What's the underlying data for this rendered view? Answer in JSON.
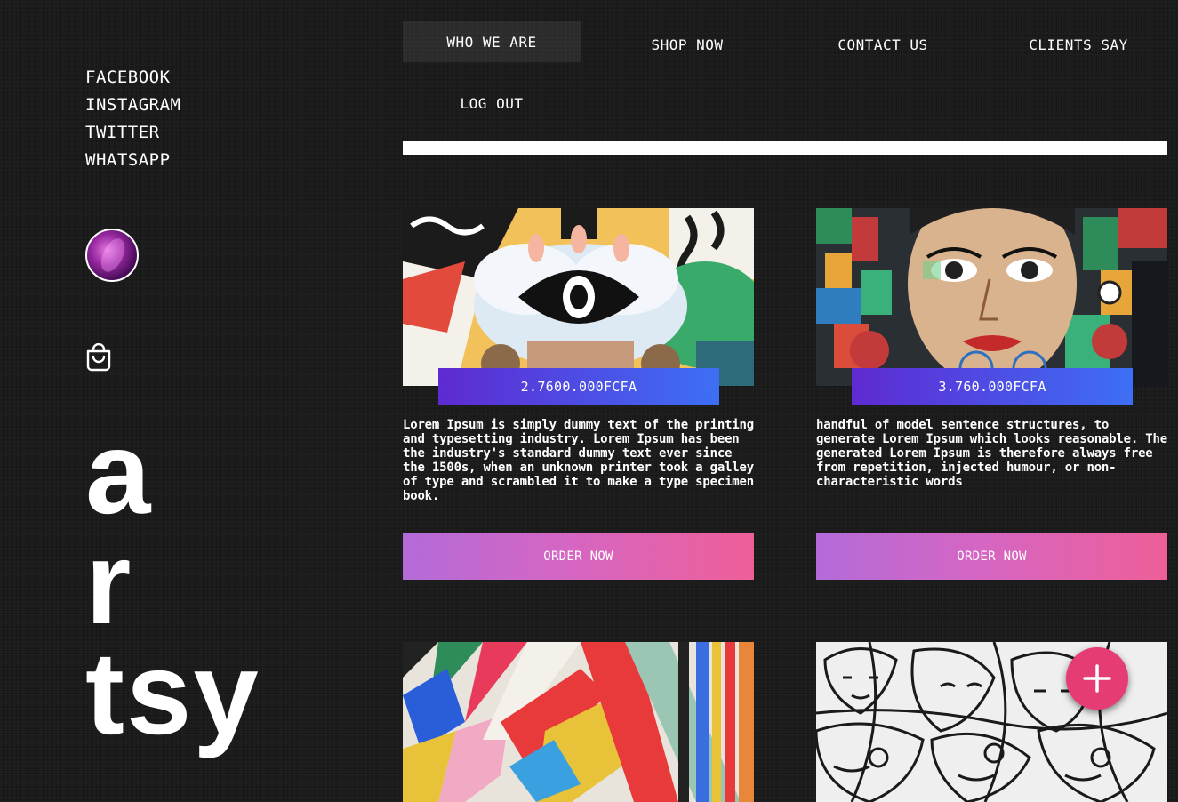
{
  "social": [
    "FACEBOOK",
    "INSTAGRAM",
    "TWITTER",
    "WHATSAPP"
  ],
  "brand": {
    "line1": "a",
    "line2": "r",
    "line3": "tsy"
  },
  "nav": {
    "who_we_are": "WHO WE ARE",
    "shop_now": "SHOP NOW",
    "contact_us": "CONTACT US",
    "clients_say": "CLIENTS SAY",
    "log_out": "LOG OUT"
  },
  "products": [
    {
      "price": "2.7600.000FCFA",
      "description": "Lorem Ipsum is simply dummy text of the printing and typesetting industry. Lorem Ipsum has been the industry's standard dummy text ever since the 1500s, when an unknown printer took a galley of type and scrambled it to make a type specimen book.",
      "order_label": "ORDER NOW"
    },
    {
      "price": "3.760.000FCFA",
      "description": "handful of model sentence structures, to generate Lorem Ipsum which looks reasonable. The generated Lorem Ipsum is therefore always free from repetition, injected humour, or non-characteristic words",
      "order_label": "ORDER NOW"
    }
  ],
  "colors": {
    "price_gradient": [
      "#5e2ad1",
      "#3d6ff5"
    ],
    "order_gradient": [
      "#b36bd9",
      "#ee5f98"
    ],
    "fab": "#e53c74"
  },
  "icons": {
    "cart": "shopping-bag-icon",
    "fab": "plus-icon"
  }
}
